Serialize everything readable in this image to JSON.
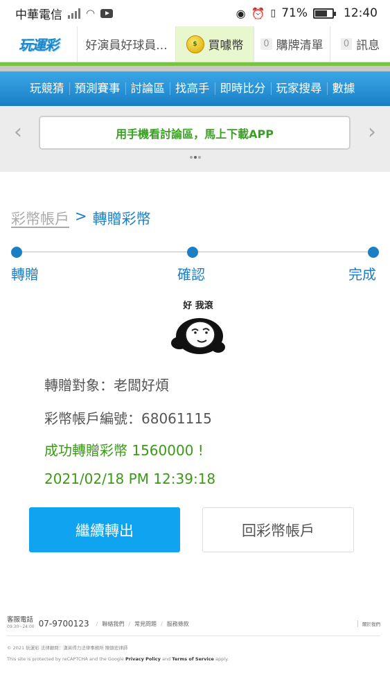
{
  "status_bar": {
    "carrier": "中華電信",
    "battery": "71%",
    "time": "12:40"
  },
  "topnav": {
    "logo": "玩運彩",
    "user": "好演員好球員...",
    "buy": "買噱幣",
    "list_count": "0",
    "list": "購牌清單",
    "msg_count": "0",
    "msg": "訊息"
  },
  "menu": [
    "玩競猜",
    "預測賽事",
    "討論區",
    "找高手",
    "即時比分",
    "玩家搜尋",
    "數據"
  ],
  "banner": {
    "text": "用手機看討論區，馬上下載APP"
  },
  "breadcrumb": {
    "parent": "彩幣帳戶",
    "separator": ">",
    "current": "轉贈彩幣"
  },
  "steps": [
    "轉贈",
    "確認",
    "完成"
  ],
  "meme": {
    "caption": "好 我滾"
  },
  "result": {
    "target": "轉贈對象：老闆好煩",
    "account": "彩幣帳戶編號：68061115",
    "success": "成功轉贈彩幣 1560000 !",
    "datetime": "2021/02/18 PM 12:39:18"
  },
  "buttons": {
    "continue": "繼續轉出",
    "back": "回彩幣帳戶"
  },
  "footer": {
    "cs_label": "客服電話",
    "cs_hours": "09:30~24:00",
    "phone": "07-9700123",
    "links": [
      "聯絡我們",
      "常見問題",
      "服務條款"
    ],
    "about": "關於我們",
    "legal": "© 2021 玩運彩 法律顧問：漢英得力法律事務所 陳鎮宏律師",
    "recaptcha_prefix": "This site is protected by reCAPTCHA and the Google",
    "privacy": "Privacy Policy",
    "and": "and",
    "terms": "Terms of Service",
    "apply": "apply."
  }
}
